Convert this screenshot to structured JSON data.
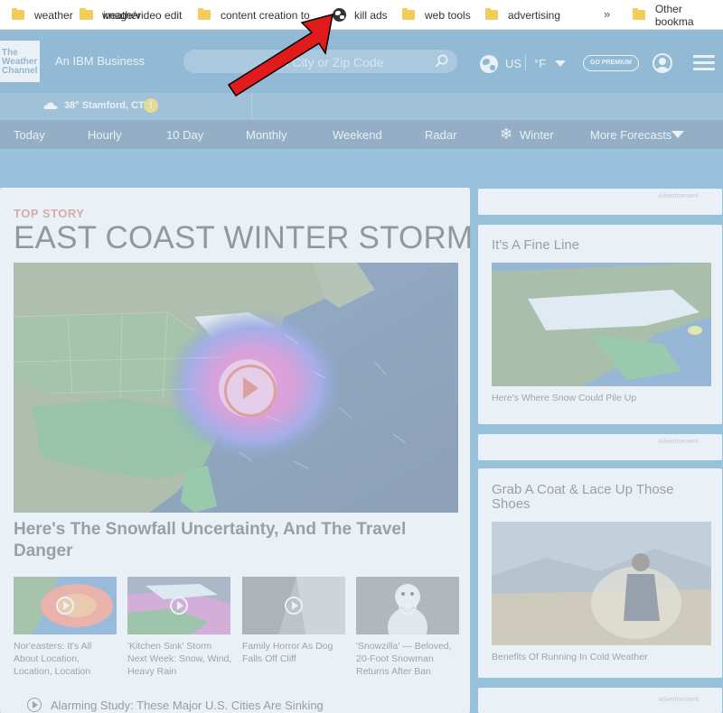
{
  "bookmarks": [
    {
      "label": "weather",
      "icon": "folder-icon"
    },
    {
      "label": "image/video edit",
      "icon": "folder-icon"
    },
    {
      "label": "content creation to",
      "icon": "folder-icon"
    },
    {
      "label": "kill ads",
      "icon": "globe-icon"
    },
    {
      "label": "web tools",
      "icon": "folder-icon"
    },
    {
      "label": "advertising",
      "icon": "folder-icon"
    },
    {
      "label": "Other bookma",
      "icon": "folder-icon"
    }
  ],
  "bookmarks_overflow": "»",
  "header": {
    "logo_lines": [
      "The",
      "Weather",
      "Channel"
    ],
    "ibm_text": "An IBM Business",
    "search_placeholder": "rch City or Zip Code",
    "unit_country": "US",
    "unit_temp": "°F",
    "premium_label": "GO PREMIUM"
  },
  "location": {
    "text": "38° Stamford, CT",
    "alert": "!"
  },
  "nav": [
    "Today",
    "Hourly",
    "10 Day",
    "Monthly",
    "Weekend",
    "Radar",
    "Winter",
    "More Forecasts"
  ],
  "main": {
    "kicker": "TOP STORY",
    "headline": "EAST COAST WINTER STORM",
    "subhead": "Here's The Snowfall Uncertainty, And The Travel Danger",
    "thumbs": [
      {
        "caption": "Nor'easters: It's All About Location, Location, Location"
      },
      {
        "caption": "'Kitchen Sink' Storm Next Week: Snow, Wind, Heavy Rain"
      },
      {
        "caption": "Family Horror As Dog Falls Off Cliff"
      },
      {
        "caption": "'Snowzilla' — Beloved, 20-Foot Snowman Returns After Ban"
      }
    ],
    "link": "Alarming Study: These Major U.S. Cities Are Sinking"
  },
  "side": {
    "ad_label": "Advertisement",
    "card1_title": "It's A Fine Line",
    "card1_caption": "Here's Where Snow Could Pile Up",
    "card2_title": "Grab A Coat & Lace Up Those Shoes",
    "card2_caption": "Benefits Of Running In Cold Weather"
  },
  "colors": {
    "header": "#1f6fa8",
    "nav": "#1d4f7e",
    "accent_red": "#d6452d",
    "overlay": "#dbe9f0"
  }
}
